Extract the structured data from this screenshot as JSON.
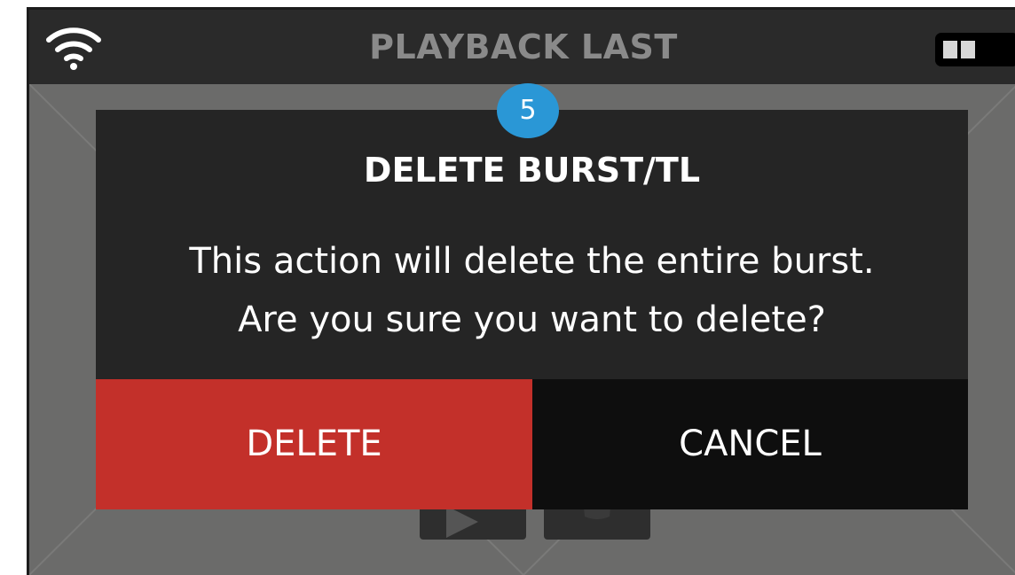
{
  "status_bar": {
    "title": "PLAYBACK LAST",
    "wifi_icon": "wifi-icon",
    "battery_icon": "battery-icon"
  },
  "step_badge": "5",
  "dialog": {
    "title": "DELETE BURST/TL",
    "message_lines": [
      "This action will delete the entire burst.",
      "Are you sure you want to delete?"
    ],
    "delete_label": "DELETE",
    "cancel_label": "CANCEL"
  },
  "background_controls": {
    "play_icon": "play-icon",
    "trash_icon": "trash-icon"
  },
  "colors": {
    "delete": "#c3302a",
    "cancel": "#0e0e0e",
    "dialog": "#252525",
    "badge": "#2a97d6",
    "title_muted": "#8a8a8a"
  }
}
